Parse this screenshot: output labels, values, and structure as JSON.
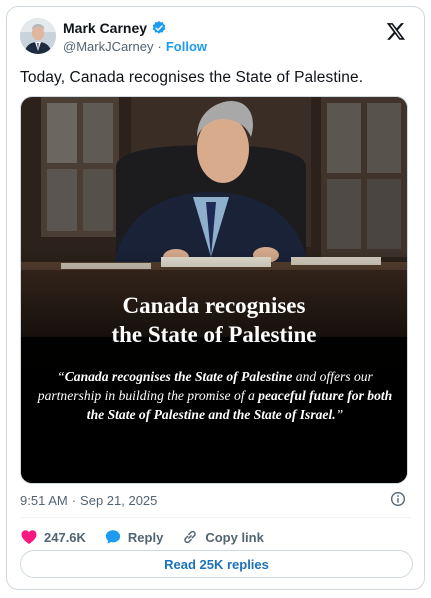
{
  "author": {
    "name": "Mark Carney",
    "handle": "@MarkJCarney",
    "separator": "·",
    "follow_label": "Follow",
    "verified": true
  },
  "tweet": {
    "text": "Today, Canada recognises the State of Palestine."
  },
  "media": {
    "headline_line1": "Canada recognises",
    "headline_line2": "the State of Palestine",
    "quote_open": "“",
    "quote_part1": "Canada recognises the State of Palestine",
    "quote_part2": " and offers our partnership in building the promise of a ",
    "quote_part3": "peaceful future for both the State of Palestine and the State of Israel.",
    "quote_close": "”"
  },
  "meta": {
    "time": "9:51 AM",
    "separator": "·",
    "date": "Sep 21, 2025"
  },
  "actions": {
    "likes": "247.6K",
    "reply_label": "Reply",
    "copy_link_label": "Copy link"
  },
  "read_replies_label": "Read 25K replies",
  "colors": {
    "accent": "#1d9bf0",
    "like": "#f91880",
    "secondary_text": "#536471",
    "border": "#cfd9de"
  }
}
